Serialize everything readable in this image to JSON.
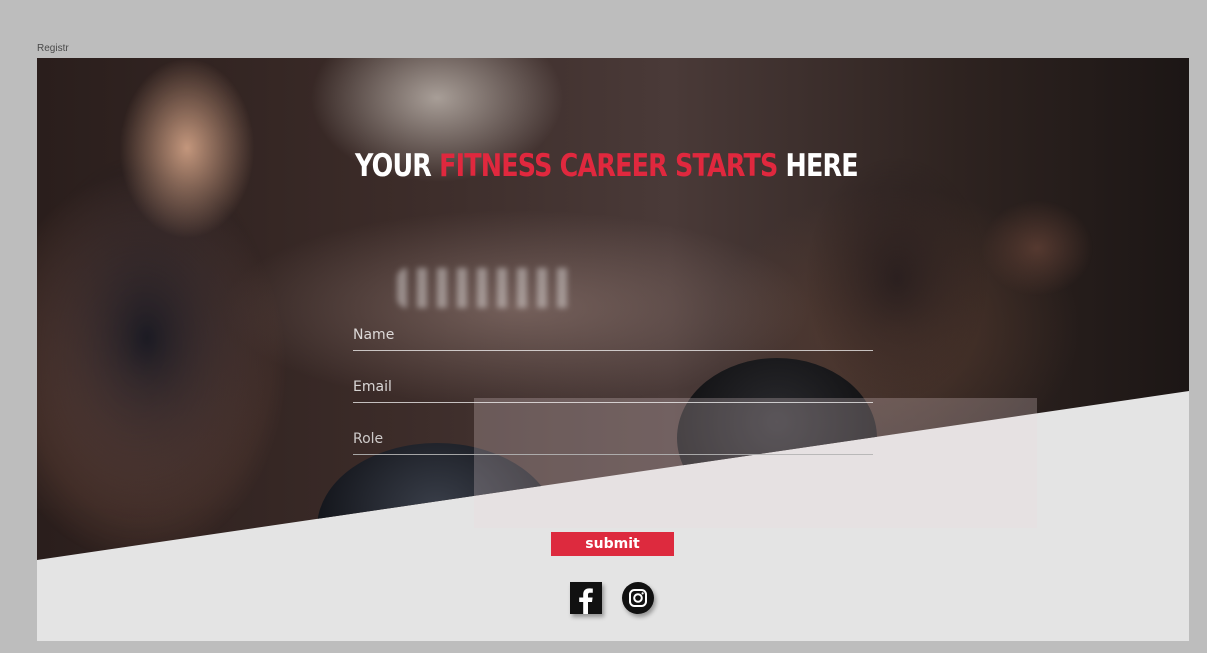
{
  "frame": {
    "label": "Registr"
  },
  "hero": {
    "headline_part1": "YOUR",
    "headline_part2": "FITNESS  CAREER STARTS",
    "headline_part3": "HERE",
    "accent_color": "#e0283e"
  },
  "form": {
    "name_placeholder": "Name",
    "email_placeholder": "Email",
    "role_placeholder": "Role",
    "submit_label": "submit",
    "submit_color": "#dd2a3e"
  },
  "social": {
    "icons": [
      "facebook-icon",
      "instagram-icon"
    ]
  }
}
